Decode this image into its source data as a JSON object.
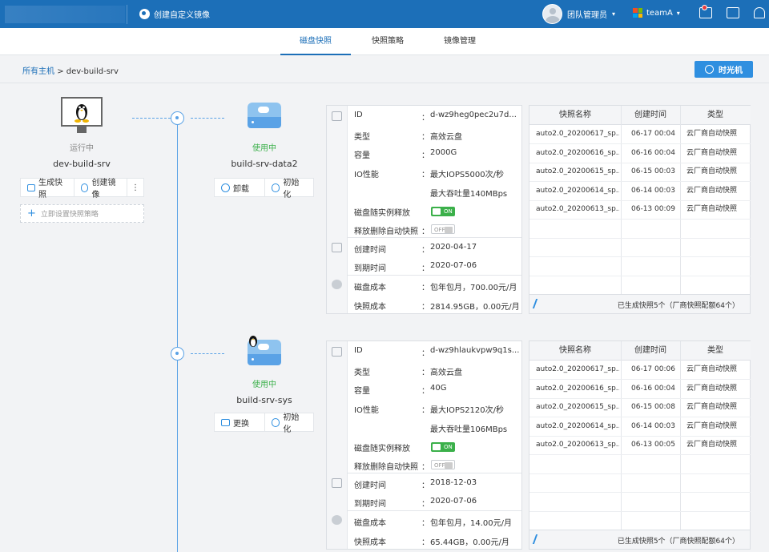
{
  "header": {
    "title": "创建自定义镜像",
    "user_label": "团队管理员",
    "team_label": "teamA",
    "colors": {
      "bar": "#1c6fb8",
      "accent": "#2f8fe0",
      "ok": "#3bb04a"
    }
  },
  "tabs": [
    {
      "label": "磁盘快照",
      "active": true
    },
    {
      "label": "快照策略",
      "active": false
    },
    {
      "label": "镜像管理",
      "active": false
    }
  ],
  "breadcrumb": {
    "root": "所有主机",
    "separator": ">",
    "current": "dev-build-srv"
  },
  "time_machine_label": "时光机",
  "host": {
    "status": "运行中",
    "name": "dev-build-srv",
    "snapshot_button": "生成快照",
    "image_button": "创建镜像",
    "more": "⋮",
    "policy_link": "立即设置快照策略"
  },
  "disks": [
    {
      "status": "使用中",
      "name": "build-srv-data2",
      "btn1": "卸载",
      "btn2": "初始化",
      "info": {
        "id_label": "ID",
        "id_value": "d-wz9heg0pec2u7d...",
        "type_label": "类型",
        "type_value": "高效云盘",
        "cap_label": "容量",
        "cap_value": "2000G",
        "io_label": "IO性能",
        "io_value1": "最大IOPS5000次/秒",
        "io_value2": "最大吞吐量140MBps",
        "release_label": "磁盘随实例释放",
        "release_state": "ON",
        "autosnap_label": "释放删除自动快照",
        "autosnap_state": "OFF",
        "created_label": "创建时间",
        "created_value": "2020-04-17",
        "expire_label": "到期时间",
        "expire_value": "2020-07-06",
        "cost_label": "磁盘成本",
        "cost_value": "包年包月，700.00元/月",
        "snapcost_label": "快照成本",
        "snapcost_value": "2814.95GB，0.00元/月",
        "colon": "："
      },
      "table": {
        "headers": [
          "快照名称",
          "创建时间",
          "类型"
        ],
        "rows": [
          [
            "auto2.0_20200617_sp...",
            "06-17 00:04",
            "云厂商自动快照"
          ],
          [
            "auto2.0_20200616_sp...",
            "06-16 00:04",
            "云厂商自动快照"
          ],
          [
            "auto2.0_20200615_sp...",
            "06-15 00:03",
            "云厂商自动快照"
          ],
          [
            "auto2.0_20200614_sp...",
            "06-14 00:03",
            "云厂商自动快照"
          ],
          [
            "auto2.0_20200613_sp...",
            "06-13 00:09",
            "云厂商自动快照"
          ]
        ],
        "footer": "已生成快照5个（厂商快照配额64个）"
      }
    },
    {
      "status": "使用中",
      "name": "build-srv-sys",
      "btn1": "更换",
      "btn2": "初始化",
      "info": {
        "id_label": "ID",
        "id_value": "d-wz9hlaukvpw9q1s...",
        "type_label": "类型",
        "type_value": "高效云盘",
        "cap_label": "容量",
        "cap_value": "40G",
        "io_label": "IO性能",
        "io_value1": "最大IOPS2120次/秒",
        "io_value2": "最大吞吐量106MBps",
        "release_label": "磁盘随实例释放",
        "release_state": "ON",
        "autosnap_label": "释放删除自动快照",
        "autosnap_state": "OFF",
        "created_label": "创建时间",
        "created_value": "2018-12-03",
        "expire_label": "到期时间",
        "expire_value": "2020-07-06",
        "cost_label": "磁盘成本",
        "cost_value": "包年包月，14.00元/月",
        "snapcost_label": "快照成本",
        "snapcost_value": "65.44GB，0.00元/月",
        "colon": "："
      },
      "table": {
        "headers": [
          "快照名称",
          "创建时间",
          "类型"
        ],
        "rows": [
          [
            "auto2.0_20200617_sp...",
            "06-17 00:06",
            "云厂商自动快照"
          ],
          [
            "auto2.0_20200616_sp...",
            "06-16 00:04",
            "云厂商自动快照"
          ],
          [
            "auto2.0_20200615_sp...",
            "06-15 00:08",
            "云厂商自动快照"
          ],
          [
            "auto2.0_20200614_sp...",
            "06-14 00:03",
            "云厂商自动快照"
          ],
          [
            "auto2.0_20200613_sp...",
            "06-13 00:05",
            "云厂商自动快照"
          ]
        ],
        "footer": "已生成快照5个（厂商快照配额64个）"
      }
    }
  ]
}
